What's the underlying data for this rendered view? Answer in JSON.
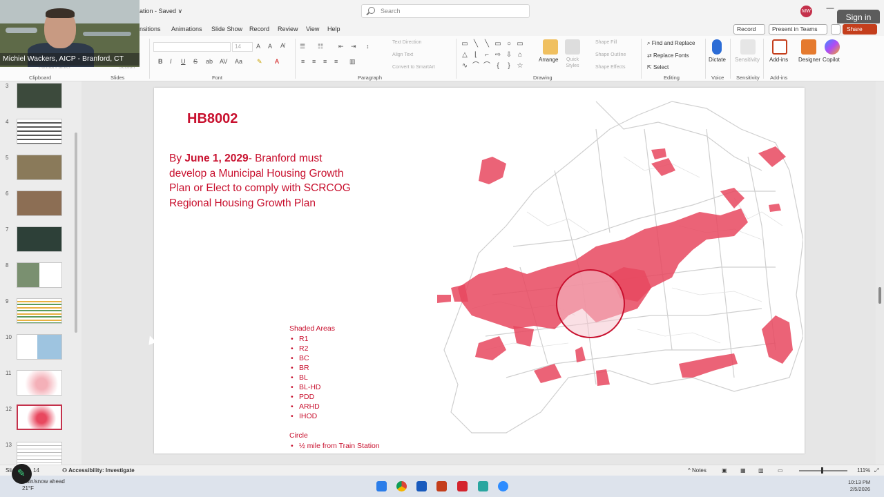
{
  "titlebar": {
    "doc_title": "ation - Saved ∨",
    "search_placeholder": "Search",
    "avatar_initials": "MW",
    "minimize": "—",
    "sign_in": "Sign in"
  },
  "tabs": [
    "nsitions",
    "Animations",
    "Slide Show",
    "Record",
    "Review",
    "View",
    "Help"
  ],
  "top_buttons": {
    "record": "Record",
    "present_in_teams": "Present in Teams",
    "share": "Share"
  },
  "ribbon": {
    "partial_labels": {
      "format_painter": "Format Painter",
      "section": "Section"
    },
    "font_size": "14",
    "paragraph_items": {
      "text_direction": "Text Direction",
      "align_text": "Align Text",
      "convert_smartart": "Convert to SmartArt"
    },
    "drawing_items": {
      "arrange": "Arrange",
      "quick_styles": "Quick Styles",
      "shape_fill": "Shape Fill",
      "shape_outline": "Shape Outline",
      "shape_effects": "Shape Effects"
    },
    "editing_items": {
      "find_replace": "Find and Replace",
      "replace_fonts": "Replace Fonts",
      "select": "Select"
    },
    "voice": {
      "dictate": "Dictate"
    },
    "sensitivity": {
      "label": "Sensitivity"
    },
    "addins": {
      "add_ins": "Add-ins"
    },
    "designer": "Designer",
    "copilot": "Copilot",
    "group_labels": {
      "clipboard": "Clipboard",
      "slides": "Slides",
      "font": "Font",
      "paragraph": "Paragraph",
      "drawing": "Drawing",
      "editing": "Editing",
      "voice": "Voice",
      "sensitivity": "Sensitivity",
      "addins": "Add-ins"
    }
  },
  "webcam": {
    "caption": "Michiel Wackers, AICP - Branford, CT"
  },
  "slides_pane": {
    "numbers": [
      "3",
      "4",
      "5",
      "6",
      "7",
      "8",
      "9",
      "10",
      "11",
      "12",
      "13"
    ],
    "active": "12"
  },
  "slide": {
    "title": "HB8002",
    "body_pre": "By ",
    "body_bold": "June 1, 2029",
    "body_post": "- Branford must develop a Municipal Housing Growth Plan or Elect to comply with SCRCOG Regional Housing Growth Plan",
    "legend_heading": "Shaded Areas",
    "legend_items": [
      "R1",
      "R2",
      "BC",
      "BR",
      "BL",
      "BL-HD",
      "PDD",
      "ARHD",
      "IHOD"
    ],
    "circle_heading": "Circle",
    "circle_item": "½ mile from Train Station"
  },
  "colors": {
    "accent": "#c8102e",
    "shade": "#e8485f",
    "share": "#c43e1c"
  },
  "statusbar": {
    "slide": "Sli",
    "slide_count": "14",
    "accessibility": "Accessibility: Investigate",
    "notes": "Notes",
    "zoom": "111%"
  },
  "taskbar": {
    "weather_line1": "Rain/snow ahead",
    "weather_line2": "21°F",
    "time": "10:13 PM",
    "date": "2/5/2026"
  }
}
